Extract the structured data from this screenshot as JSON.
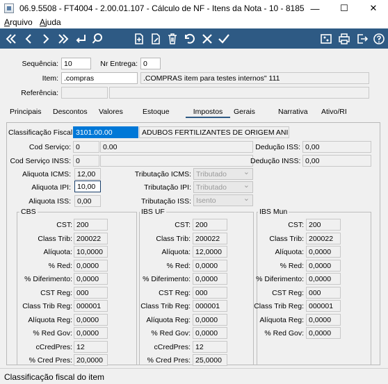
{
  "window": {
    "title": "06.9.5508 - FT4004 - 2.00.01.107 - Cálculo de NF - Itens da Nota - 10 - 8185",
    "minimize_glyph": "—",
    "maximize_glyph": "☐",
    "close_glyph": "✕"
  },
  "menu": {
    "items": [
      {
        "pre": "",
        "hot": "A",
        "post": "rquivo"
      },
      {
        "pre": "",
        "hot": "A",
        "post": "juda"
      }
    ]
  },
  "toolbar": {
    "color": "#2e5a84",
    "icons": [
      "first-icon",
      "previous-icon",
      "next-icon",
      "last-icon",
      "enter-icon",
      "search-icon",
      "new-document-icon",
      "edit-document-icon",
      "delete-icon",
      "undo-icon",
      "cancel-icon",
      "confirm-icon",
      "settings-icon",
      "print-icon",
      "exit-icon"
    ],
    "glyphs": {
      "first": "«",
      "previous": "‹",
      "next": "›",
      "last": "»",
      "enter": "↵",
      "search": "⚲",
      "new": "🗋",
      "edit": "🖉",
      "delete": "🗑",
      "undo": "↶",
      "cancel": "✕",
      "confirm": "✓",
      "settings": "⚙",
      "print": "⎙",
      "exit": "⇥"
    }
  },
  "header": {
    "sequencia_label": "Sequência:",
    "sequencia_value": "10",
    "nr_entrega_label": "Nr Entrega:",
    "nr_entrega_value": "0",
    "item_label": "Item:",
    "item_code": ".compras",
    "item_desc": ".COMPRAS item para testes internos\" 111",
    "referencia_label": "Referência:",
    "referencia_code": "",
    "referencia_desc": ""
  },
  "tabs": [
    {
      "label": "Principais",
      "active": false
    },
    {
      "label": "Descontos",
      "active": false
    },
    {
      "label": "Valores",
      "active": false
    },
    {
      "label": "Estoque",
      "active": false
    },
    {
      "label": "Impostos",
      "active": true
    },
    {
      "label": "Gerais",
      "active": false
    },
    {
      "label": "Narrativa",
      "active": false
    },
    {
      "label": "Ativo/RI",
      "active": false
    }
  ],
  "impostos": {
    "classificacao_fiscal_label": "Classificação Fiscal:",
    "classificacao_fiscal_value": "3101.00.00",
    "classificacao_fiscal_desc": "ADUBOS FERTILIZANTES DE ORIGEM ANIM",
    "cod_servico_label": "Cod Serviço:",
    "cod_servico_value": "0",
    "cod_servico_desc": "0.00",
    "deducao_iss_label": "Dedução ISS:",
    "deducao_iss_value": "0,00",
    "cod_servico_inss_label": "Cod Serviço INSS:",
    "cod_servico_inss_value": "0",
    "deducao_inss_label": "Dedução INSS:",
    "deducao_inss_value": "0,00",
    "aliquota_icms_label": "Aliquota ICMS:",
    "aliquota_icms_value": "12,00",
    "tributacao_icms_label": "Tributação ICMS:",
    "tributacao_icms_value": "Tributado",
    "aliquota_ipi_label": "Aliquota IPI:",
    "aliquota_ipi_value": "10,00",
    "tributacao_ipi_label": "Tributação IPI:",
    "tributacao_ipi_value": "Tributado",
    "aliquota_iss_label": "Aliquota ISS:",
    "aliquota_iss_value": "0,00",
    "tributacao_iss_label": "Tributação ISS:",
    "tributacao_iss_value": "Isento"
  },
  "groups": {
    "cbs": {
      "title": "CBS",
      "rows": [
        {
          "label": "CST:",
          "value": "200"
        },
        {
          "label": "Class Trib:",
          "value": "200022"
        },
        {
          "label": "Alíquota:",
          "value": "10,0000"
        },
        {
          "label": "% Red:",
          "value": "0,0000"
        },
        {
          "label": "% Diferimento:",
          "value": "0,0000"
        },
        {
          "label": "CST Reg:",
          "value": "000"
        },
        {
          "label": "Class Trib Reg:",
          "value": "000001"
        },
        {
          "label": "Alíquota Reg:",
          "value": "0,0000"
        },
        {
          "label": "% Red Gov:",
          "value": "0,0000"
        },
        {
          "label": "cCredPres:",
          "value": "12"
        },
        {
          "label": "% Cred Pres:",
          "value": "20,0000"
        }
      ]
    },
    "ibs_uf": {
      "title": "IBS UF",
      "rows": [
        {
          "label": "CST:",
          "value": "200"
        },
        {
          "label": "Class Trib:",
          "value": "200022"
        },
        {
          "label": "Alíquota:",
          "value": "12,0000"
        },
        {
          "label": "% Red:",
          "value": "0,0000"
        },
        {
          "label": "% Diferimento:",
          "value": "0,0000"
        },
        {
          "label": "CST Reg:",
          "value": "000"
        },
        {
          "label": "Class Trib Reg:",
          "value": "000001"
        },
        {
          "label": "Alíquota Reg:",
          "value": "0,0000"
        },
        {
          "label": "% Red Gov:",
          "value": "0,0000"
        },
        {
          "label": "cCredPres:",
          "value": "12"
        },
        {
          "label": "% Cred Pres:",
          "value": "25,0000"
        }
      ]
    },
    "ibs_mun": {
      "title": "IBS Mun",
      "rows": [
        {
          "label": "CST:",
          "value": "200"
        },
        {
          "label": "Class Trib:",
          "value": "200022"
        },
        {
          "label": "Alíquota:",
          "value": "0,0000"
        },
        {
          "label": "% Red:",
          "value": "0,0000"
        },
        {
          "label": "% Diferimento:",
          "value": "0,0000"
        },
        {
          "label": "CST Reg:",
          "value": "000"
        },
        {
          "label": "Class Trib Reg:",
          "value": "000001"
        },
        {
          "label": "Alíquota Reg:",
          "value": "0,0000"
        },
        {
          "label": "% Red Gov:",
          "value": "0,0000"
        }
      ]
    }
  },
  "status": {
    "text": "Classificação fiscal do item"
  }
}
